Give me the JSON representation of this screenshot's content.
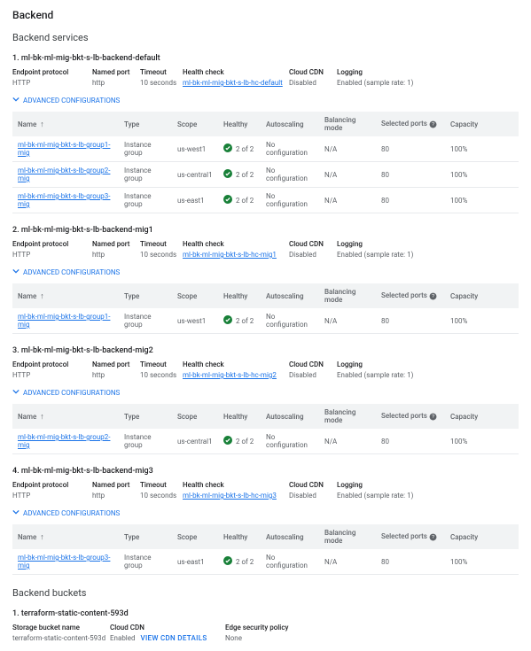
{
  "headings": {
    "backend": "Backend",
    "backend_services": "Backend services",
    "backend_buckets": "Backend buckets"
  },
  "meta_labels": {
    "endpoint_protocol": "Endpoint protocol",
    "named_port": "Named port",
    "timeout": "Timeout",
    "health_check": "Health check",
    "cloud_cdn": "Cloud CDN",
    "logging": "Logging"
  },
  "table_headers": {
    "name": "Name",
    "type": "Type",
    "scope": "Scope",
    "healthy": "Healthy",
    "autoscaling": "Autoscaling",
    "balancing_mode": "Balancing mode",
    "selected_ports": "Selected ports",
    "capacity": "Capacity"
  },
  "adv_label": "ADVANCED CONFIGURATIONS",
  "services": [
    {
      "title": "1. ml-bk-ml-mig-bkt-s-lb-backend-default",
      "meta": {
        "ep": "HTTP",
        "np": "http",
        "to": "10 seconds",
        "hc": "ml-bk-ml-mig-bkt-s-lb-hc-default",
        "cdn": "Disabled",
        "log": "Enabled (sample rate: 1)"
      },
      "rows": [
        {
          "name": "ml-bk-ml-mig-bkt-s-lb-group1-mig",
          "type": "Instance group",
          "scope": "us-west1",
          "healthy": "2 of 2",
          "auto": "No configuration",
          "bal": "N/A",
          "ports": "80",
          "cap": "100%"
        },
        {
          "name": "ml-bk-ml-mig-bkt-s-lb-group2-mig",
          "type": "Instance group",
          "scope": "us-central1",
          "healthy": "2 of 2",
          "auto": "No configuration",
          "bal": "N/A",
          "ports": "80",
          "cap": "100%"
        },
        {
          "name": "ml-bk-ml-mig-bkt-s-lb-group3-mig",
          "type": "Instance group",
          "scope": "us-east1",
          "healthy": "2 of 2",
          "auto": "No configuration",
          "bal": "N/A",
          "ports": "80",
          "cap": "100%"
        }
      ]
    },
    {
      "title": "2. ml-bk-ml-mig-bkt-s-lb-backend-mig1",
      "meta": {
        "ep": "HTTP",
        "np": "http",
        "to": "10 seconds",
        "hc": "ml-bk-ml-mig-bkt-s-lb-hc-mig1",
        "cdn": "Disabled",
        "log": "Enabled (sample rate: 1)"
      },
      "rows": [
        {
          "name": "ml-bk-ml-mig-bkt-s-lb-group1-mig",
          "type": "Instance group",
          "scope": "us-west1",
          "healthy": "2 of 2",
          "auto": "No configuration",
          "bal": "N/A",
          "ports": "80",
          "cap": "100%"
        }
      ]
    },
    {
      "title": "3. ml-bk-ml-mig-bkt-s-lb-backend-mig2",
      "meta": {
        "ep": "HTTP",
        "np": "http",
        "to": "10 seconds",
        "hc": "ml-bk-ml-mig-bkt-s-lb-hc-mig2",
        "cdn": "Disabled",
        "log": "Enabled (sample rate: 1)"
      },
      "rows": [
        {
          "name": "ml-bk-ml-mig-bkt-s-lb-group2-mig",
          "type": "Instance group",
          "scope": "us-central1",
          "healthy": "2 of 2",
          "auto": "No configuration",
          "bal": "N/A",
          "ports": "80",
          "cap": "100%"
        }
      ]
    },
    {
      "title": "4. ml-bk-ml-mig-bkt-s-lb-backend-mig3",
      "meta": {
        "ep": "HTTP",
        "np": "http",
        "to": "10 seconds",
        "hc": "ml-bk-ml-mig-bkt-s-lb-hc-mig3",
        "cdn": "Disabled",
        "log": "Enabled (sample rate: 1)"
      },
      "rows": [
        {
          "name": "ml-bk-ml-mig-bkt-s-lb-group3-mig",
          "type": "Instance group",
          "scope": "us-east1",
          "healthy": "2 of 2",
          "auto": "No configuration",
          "bal": "N/A",
          "ports": "80",
          "cap": "100%"
        }
      ]
    }
  ],
  "bucket": {
    "title": "1. terraform-static-content-593d",
    "labels": {
      "name": "Storage bucket name",
      "cdn": "Cloud CDN",
      "esp": "Edge security policy"
    },
    "vals": {
      "name": "terraform-static-content-593d",
      "cdn": "Enabled",
      "view": "VIEW CDN DETAILS",
      "esp": "None"
    }
  }
}
